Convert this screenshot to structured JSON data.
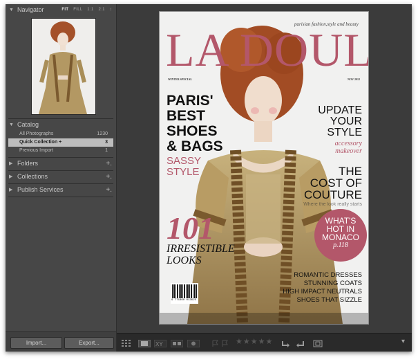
{
  "navigator": {
    "title": "Navigator",
    "zoom": [
      "FIT",
      "FILL",
      "1:1",
      "2:1"
    ],
    "zoom_arrow": "↕"
  },
  "catalog": {
    "title": "Catalog",
    "items": [
      {
        "label": "All Photographs",
        "count": "1230"
      },
      {
        "label": "Quick Collection +",
        "count": "3",
        "selected": true
      },
      {
        "label": "Previous Import",
        "count": "1"
      }
    ]
  },
  "panels": [
    {
      "label": "Folders",
      "action": "+."
    },
    {
      "label": "Collections",
      "action": "+."
    },
    {
      "label": "Publish Services",
      "action": "+."
    }
  ],
  "buttons": {
    "import": "Import...",
    "export": "Export..."
  },
  "magazine": {
    "title": "LA DOULEUR",
    "tagline": "parisian fashion,style and beauty",
    "edition_left": "WINTER SPECIAL",
    "edition_right": "NOV 2012",
    "left_headline": [
      "PARIS'",
      "BEST",
      "SHOES",
      "& BAGS"
    ],
    "left_subhead": [
      "SASSY",
      "STYLE"
    ],
    "big_number": "101",
    "big_text": [
      "IRRESISTIBLE",
      "LOOKS"
    ],
    "right_headline": [
      "UPDATE",
      "YOUR",
      "STYLE"
    ],
    "right_subhead": [
      "accessory",
      "makeover"
    ],
    "cost": [
      "THE",
      "COST OF",
      "COUTURE"
    ],
    "cost_sub": "Where the look really starts",
    "circle": [
      "WHAT'S",
      "HOT IN",
      "MONACO",
      "p.118"
    ],
    "list": [
      "ROMANTIC DRESSES",
      "STUNNING COATS",
      "HIGH IMPACT NEUTRALS",
      "SHOES THAT SIZZLE"
    ],
    "barcode_number": "9 771860 013625"
  },
  "toolbar": {
    "view_icons": [
      "grid-view-icon",
      "loupe-view-icon",
      "compare-view-icon",
      "survey-view-icon",
      "people-view-icon"
    ],
    "rating": 0,
    "expand_arrow": "▾"
  },
  "colors": {
    "accent": "#b3576a",
    "panel": "#474747",
    "toolbar": "#2a2a2a"
  }
}
